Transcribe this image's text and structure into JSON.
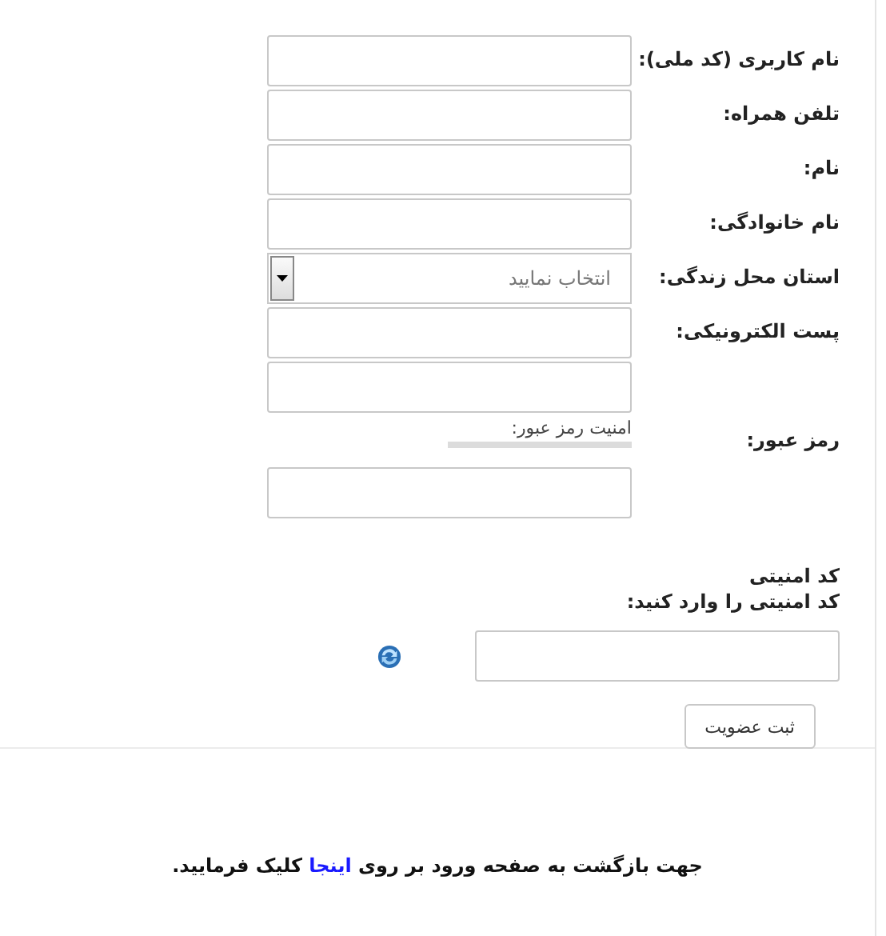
{
  "fields": [
    {
      "kind": "text",
      "label": "نام کاربری (کد ملی):"
    },
    {
      "kind": "text",
      "label": "تلفن همراه:"
    },
    {
      "kind": "text",
      "label": "نام:"
    },
    {
      "kind": "text",
      "label": "نام خانوادگی:"
    },
    {
      "kind": "select",
      "label": "استان محل زندگی:",
      "value": "انتخاب نمایید"
    },
    {
      "kind": "text",
      "label": "پست الکترونیکی:"
    },
    {
      "kind": "password",
      "label": "رمز عبور:",
      "strength_label": "امنیت رمز عبور:"
    }
  ],
  "captcha": {
    "title": "کد امنیتی",
    "prompt": "کد امنیتی را وارد کنید:"
  },
  "submit_button": "ثبت عضویت",
  "footer": {
    "before": "جهت بازگشت به صفحه ورود بر روی ",
    "link": "اینجا",
    "after": " کلیک فرمایید."
  }
}
